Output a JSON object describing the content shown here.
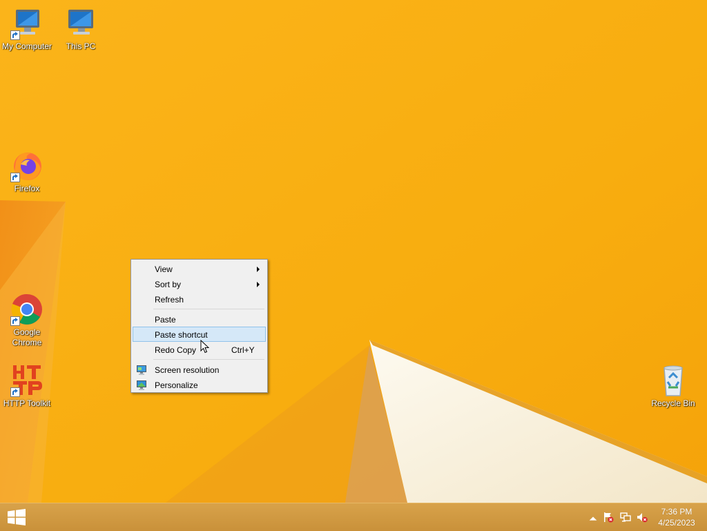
{
  "desktop_icons": [
    {
      "label": "My Computer",
      "icon": "computer-icon"
    },
    {
      "label": "This PC",
      "icon": "computer-icon"
    },
    {
      "label": "Firefox",
      "icon": "firefox-icon"
    },
    {
      "label": "Google Chrome",
      "icon": "chrome-icon"
    },
    {
      "label": "HTTP Toolkit",
      "icon": "http-toolkit-icon"
    },
    {
      "label": "Recycle Bin",
      "icon": "recycle-bin-icon"
    }
  ],
  "context_menu": {
    "items": {
      "view": "View",
      "sort_by": "Sort by",
      "refresh": "Refresh",
      "paste": "Paste",
      "paste_shortcut": "Paste shortcut",
      "redo_copy": "Redo Copy",
      "redo_copy_shortcut": "Ctrl+Y",
      "screen_resolution": "Screen resolution",
      "personalize": "Personalize"
    },
    "highlighted": "Paste shortcut"
  },
  "taskbar": {
    "clock": {
      "time": "7:36 PM",
      "date": "4/25/2023"
    }
  },
  "colors": {
    "wallpaper": "#f9b112",
    "menu_background": "#f0f0f0",
    "menu_highlight": "#d5e8f8",
    "taskbar": "#cf9a42"
  }
}
